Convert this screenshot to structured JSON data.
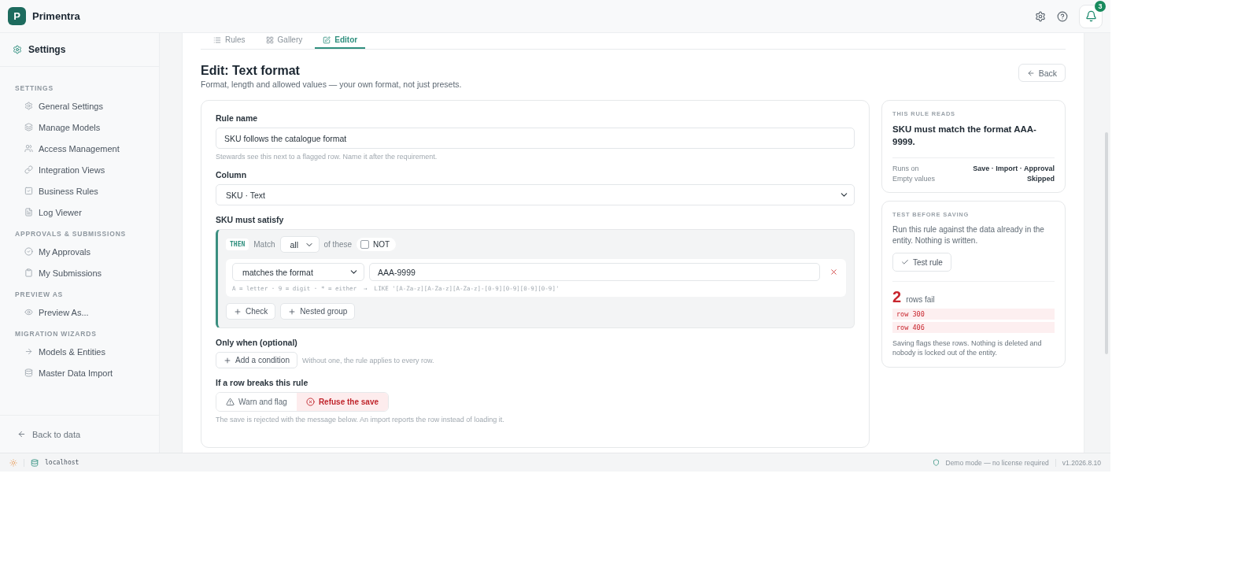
{
  "app": {
    "logo_letter": "P",
    "name": "Primentra",
    "notification_count": "3"
  },
  "sidebar": {
    "title": "Settings",
    "sections": [
      {
        "heading": "SETTINGS",
        "items": [
          "General Settings",
          "Manage Models",
          "Access Management",
          "Integration Views",
          "Business Rules",
          "Log Viewer"
        ]
      },
      {
        "heading": "APPROVALS & SUBMISSIONS",
        "items": [
          "My Approvals",
          "My Submissions"
        ]
      },
      {
        "heading": "PREVIEW AS",
        "items": [
          "Preview As..."
        ]
      },
      {
        "heading": "MIGRATION WIZARDS",
        "items": [
          "Models & Entities",
          "Master Data Import"
        ]
      }
    ],
    "back": "Back to data"
  },
  "tabs": [
    {
      "label": "Rules",
      "selected": false
    },
    {
      "label": "Gallery",
      "selected": false
    },
    {
      "label": "Editor",
      "selected": true
    }
  ],
  "page": {
    "title": "Edit: Text format",
    "subtitle": "Format, length and allowed values — your own format, not just presets.",
    "back_button": "Back"
  },
  "form": {
    "rule_name": {
      "label": "Rule name",
      "value": "SKU follows the catalogue format",
      "hint": "Stewards see this next to a flagged row. Name it after the requirement."
    },
    "column": {
      "label": "Column",
      "value": "SKU · Text"
    },
    "condition": {
      "label": "SKU must satisfy",
      "tag": "THEN",
      "match_label": "Match",
      "match_value": "all",
      "of_these": "of these",
      "not": {
        "label": "NOT",
        "checked": false
      },
      "checks": [
        {
          "operator": "matches the format",
          "value": "AAA-9999",
          "hint": "A = letter · 9 = digit · * = either  →  LIKE '[A-Za-z][A-Za-z][A-Za-z]-[0-9][0-9][0-9][0-9]'"
        }
      ],
      "add_buttons": [
        "Check",
        "Nested group"
      ]
    },
    "only_when": {
      "label": "Only when (optional)",
      "button": "Add a condition",
      "hint": "Without one, the rule applies to every row."
    },
    "on_break": {
      "label": "If a row breaks this rule",
      "options": [
        {
          "label": "Warn and flag",
          "selected": false
        },
        {
          "label": "Refuse the save",
          "selected": true
        }
      ],
      "hint": "The save is rejected with the message below. An import reports the row instead of loading it."
    }
  },
  "summary": {
    "heading": "THIS RULE READS",
    "text": "SKU must match the format AAA-9999.",
    "facts": [
      {
        "label": "Runs on",
        "value": "Save · Import · Approval"
      },
      {
        "label": "Empty values",
        "value": "Skipped"
      }
    ]
  },
  "test": {
    "heading": "TEST BEFORE SAVING",
    "text": "Run this rule against the data already in the entity. Nothing is written.",
    "button": "Test rule",
    "count": "2",
    "count_label": "rows fail",
    "rows": [
      "row 300",
      "row 406"
    ],
    "note": "Saving flags these rows. Nothing is deleted and nobody is locked out of the entity."
  },
  "status_bar": {
    "host": "localhost",
    "mode": "Demo mode — no license required",
    "version": "v1.2026.8.10"
  }
}
